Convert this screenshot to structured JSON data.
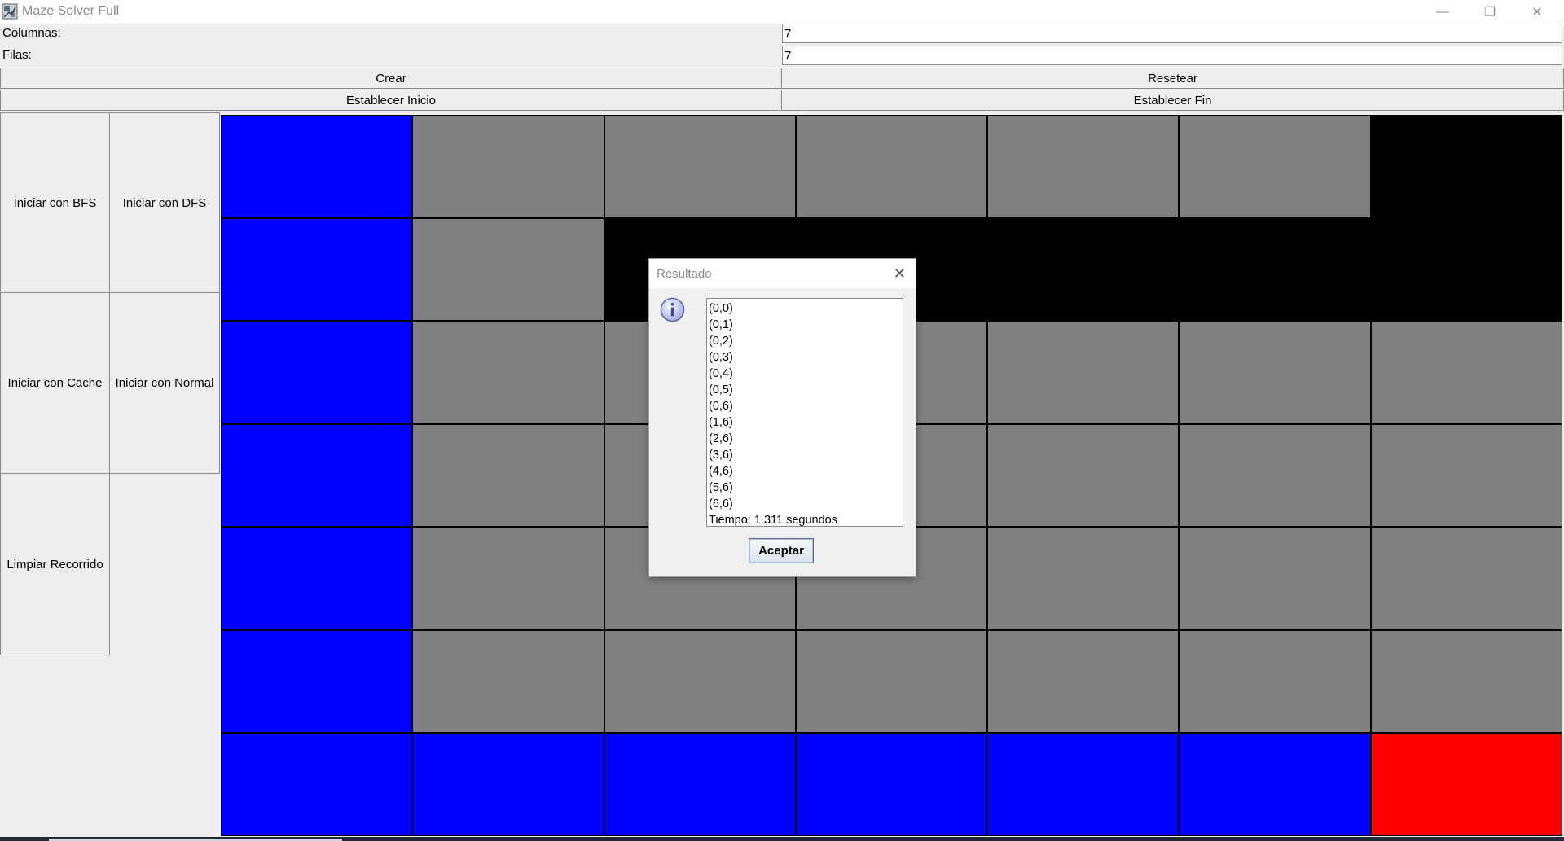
{
  "window": {
    "title": "Maze Solver Full",
    "minimize_glyph": "—",
    "restore_glyph": "❐",
    "close_glyph": "✕"
  },
  "form": {
    "columns_label": "Columnas:",
    "columns_value": "7",
    "rows_label": "Filas:",
    "rows_value": "7"
  },
  "buttons": {
    "crear": "Crear",
    "resetear": "Resetear",
    "establecer_inicio": "Establecer Inicio",
    "establecer_fin": "Establecer Fin",
    "iniciar_bfs": "Iniciar con BFS",
    "iniciar_dfs": "Iniciar con DFS",
    "iniciar_cache": "Iniciar con Cache",
    "iniciar_normal": "Iniciar con Normal",
    "limpiar_recorrido": "Limpiar Recorrido"
  },
  "maze": {
    "rows": 7,
    "cols": 7,
    "legend_colors": {
      "B": "#0000ff",
      "G": "#808080",
      "K": "#000000",
      "R": "#ff0000"
    },
    "cells": [
      [
        "B",
        "G",
        "G",
        "G",
        "G",
        "G",
        "K"
      ],
      [
        "B",
        "G",
        "K",
        "K",
        "K",
        "K",
        "K"
      ],
      [
        "B",
        "G",
        "G",
        "G",
        "G",
        "G",
        "G"
      ],
      [
        "B",
        "G",
        "G",
        "G",
        "G",
        "G",
        "G"
      ],
      [
        "B",
        "G",
        "G",
        "G",
        "G",
        "G",
        "G"
      ],
      [
        "B",
        "G",
        "G",
        "G",
        "G",
        "G",
        "G"
      ],
      [
        "B",
        "B",
        "B",
        "B",
        "B",
        "B",
        "R"
      ]
    ]
  },
  "dialog": {
    "title": "Resultado",
    "close_glyph": "✕",
    "icon": "info-icon",
    "lines": [
      "(0,0)",
      "(0,1)",
      "(0,2)",
      "(0,3)",
      "(0,4)",
      "(0,5)",
      "(0,6)",
      "(1,6)",
      "(2,6)",
      "(3,6)",
      "(4,6)",
      "(5,6)",
      "(6,6)",
      "Tiempo: 1.311 segundos"
    ],
    "ok_label": "Aceptar"
  }
}
